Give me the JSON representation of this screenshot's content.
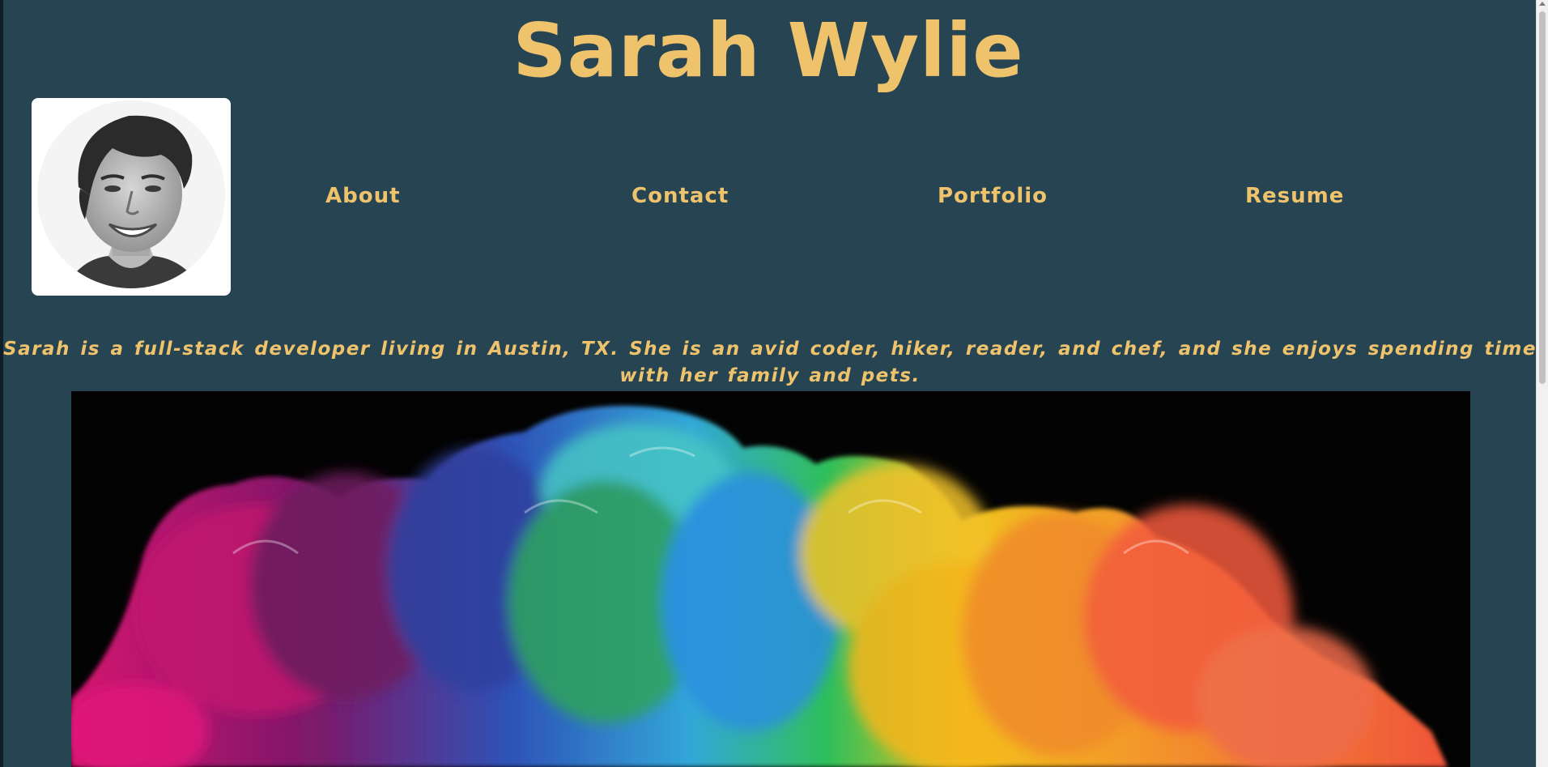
{
  "header": {
    "title": "Sarah Wylie"
  },
  "profile": {
    "avatar_alt": "Portrait of Sarah Wylie"
  },
  "nav": {
    "items": [
      {
        "label": "About"
      },
      {
        "label": "Contact"
      },
      {
        "label": "Portfolio"
      },
      {
        "label": "Resume"
      }
    ]
  },
  "bio": {
    "text": "Sarah is a full-stack developer living in Austin, TX. She is an avid coder, hiker, reader, and chef, and she enjoys spending time with her family and pets."
  },
  "hero": {
    "alt": "Colorful ink cloud on black background"
  },
  "colors": {
    "background": "#274453",
    "accent": "#efc36c"
  }
}
